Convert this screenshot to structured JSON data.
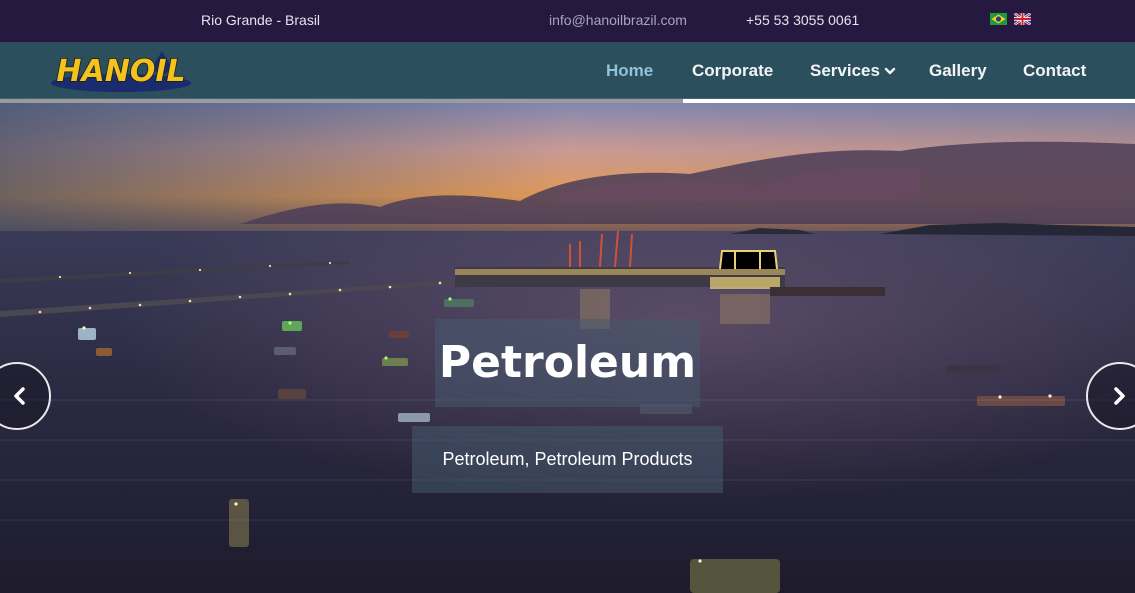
{
  "topbar": {
    "location": "Rio Grande - Brasil",
    "email": "info@hanoilbrazil.com",
    "phone": "+55 53 3055 0061",
    "languages": [
      "pt-BR flag",
      "en-GB flag"
    ]
  },
  "header": {
    "logo_text": "HANOIL",
    "nav": [
      {
        "label": "Home",
        "active": true
      },
      {
        "label": "Corporate"
      },
      {
        "label": "Services",
        "dropdown": true
      },
      {
        "label": "Gallery"
      },
      {
        "label": "Contact"
      }
    ],
    "colors": {
      "topbar": "#25193f",
      "navbar": "#2b4f5c",
      "active": "#8fc3db"
    }
  },
  "hero": {
    "title": "Petroleum",
    "subtitle": "Petroleum, Petroleum Products",
    "progress": 0.6,
    "prev_icon": "chevron-left-icon",
    "next_icon": "chevron-right-icon"
  }
}
